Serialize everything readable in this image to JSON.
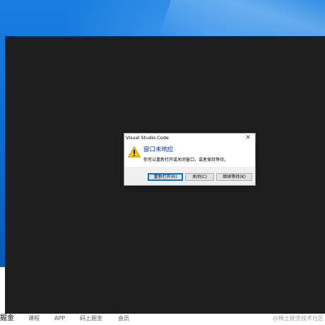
{
  "dialog": {
    "title": "Visual Studio Code",
    "heading": "窗口未响应",
    "message": "你可以重新打开或关闭窗口，或者保持等待。",
    "buttons": {
      "reopen": "重新打开(R)",
      "close": "关闭(C)",
      "wait": "继续等待(K)"
    },
    "close_glyph": "✕",
    "icon": "warning-icon"
  },
  "background_page": {
    "nav": {
      "logo": "掘金",
      "items": [
        "课程",
        "APP",
        "码上掘金",
        "会员"
      ]
    },
    "watermark": "@稀土掘金技术社区"
  },
  "colors": {
    "desktop_blue": "#0d6fd4",
    "app_dark": "#1e1e1e",
    "heading_blue": "#003399",
    "button_focus": "#0078d7",
    "warning_yellow": "#f6c700"
  }
}
